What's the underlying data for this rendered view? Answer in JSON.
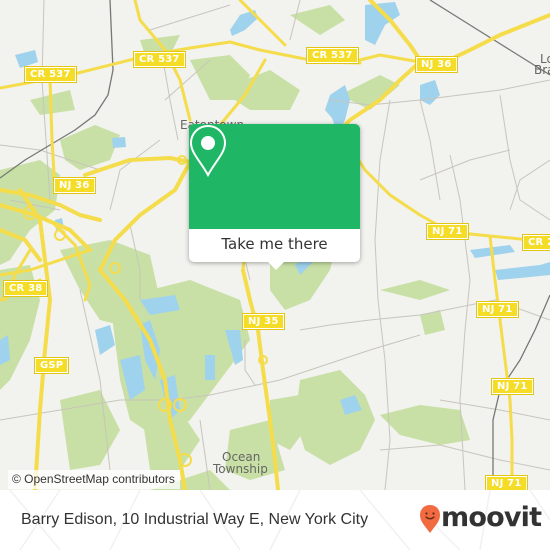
{
  "map": {
    "colors": {
      "land": "#f2f2ee",
      "forest": "#c8e0a5",
      "water": "#9fd2ec",
      "major_road": "#f5dc4a",
      "minor_road": "#c7c5bd",
      "railway": "#777777",
      "shield_fill": "#f5dc26"
    },
    "road_shields": [
      {
        "id": "cr537-west",
        "label": "CR 537"
      },
      {
        "id": "cr537-center",
        "label": "CR 537"
      },
      {
        "id": "cr537-east",
        "label": "CR 537"
      },
      {
        "id": "nj36-west",
        "label": "NJ 36"
      },
      {
        "id": "nj36-east",
        "label": "NJ 36"
      },
      {
        "id": "nj71-north",
        "label": "NJ 71"
      },
      {
        "id": "cr2-east",
        "label": "CR 2"
      },
      {
        "id": "nj71-mid",
        "label": "NJ 71"
      },
      {
        "id": "nj71-south",
        "label": "NJ 71"
      },
      {
        "id": "nj71-bottom",
        "label": "NJ 71"
      },
      {
        "id": "cr38",
        "label": "CR 38"
      },
      {
        "id": "nj35",
        "label": "NJ 35"
      },
      {
        "id": "gsp",
        "label": "GSP"
      }
    ],
    "places": [
      {
        "id": "eatontown",
        "label": "Eatontown"
      },
      {
        "id": "ocean-township-1",
        "label": "Ocean"
      },
      {
        "id": "ocean-township-2",
        "label": "Township"
      },
      {
        "id": "long-branch-1",
        "label": "Lo"
      },
      {
        "id": "long-branch-2",
        "label": "Bra"
      }
    ],
    "attribution": "© OpenStreetMap contributors"
  },
  "popup": {
    "icon": "location-pin-icon",
    "button_label": "Take me there",
    "color": "#1fb766"
  },
  "footer": {
    "address": "Barry Edison, 10 Industrial Way E, New York City",
    "brand": "moovit",
    "brand_icon": "moovit-smiley-pin-icon",
    "brand_color": "#f26a3f"
  }
}
